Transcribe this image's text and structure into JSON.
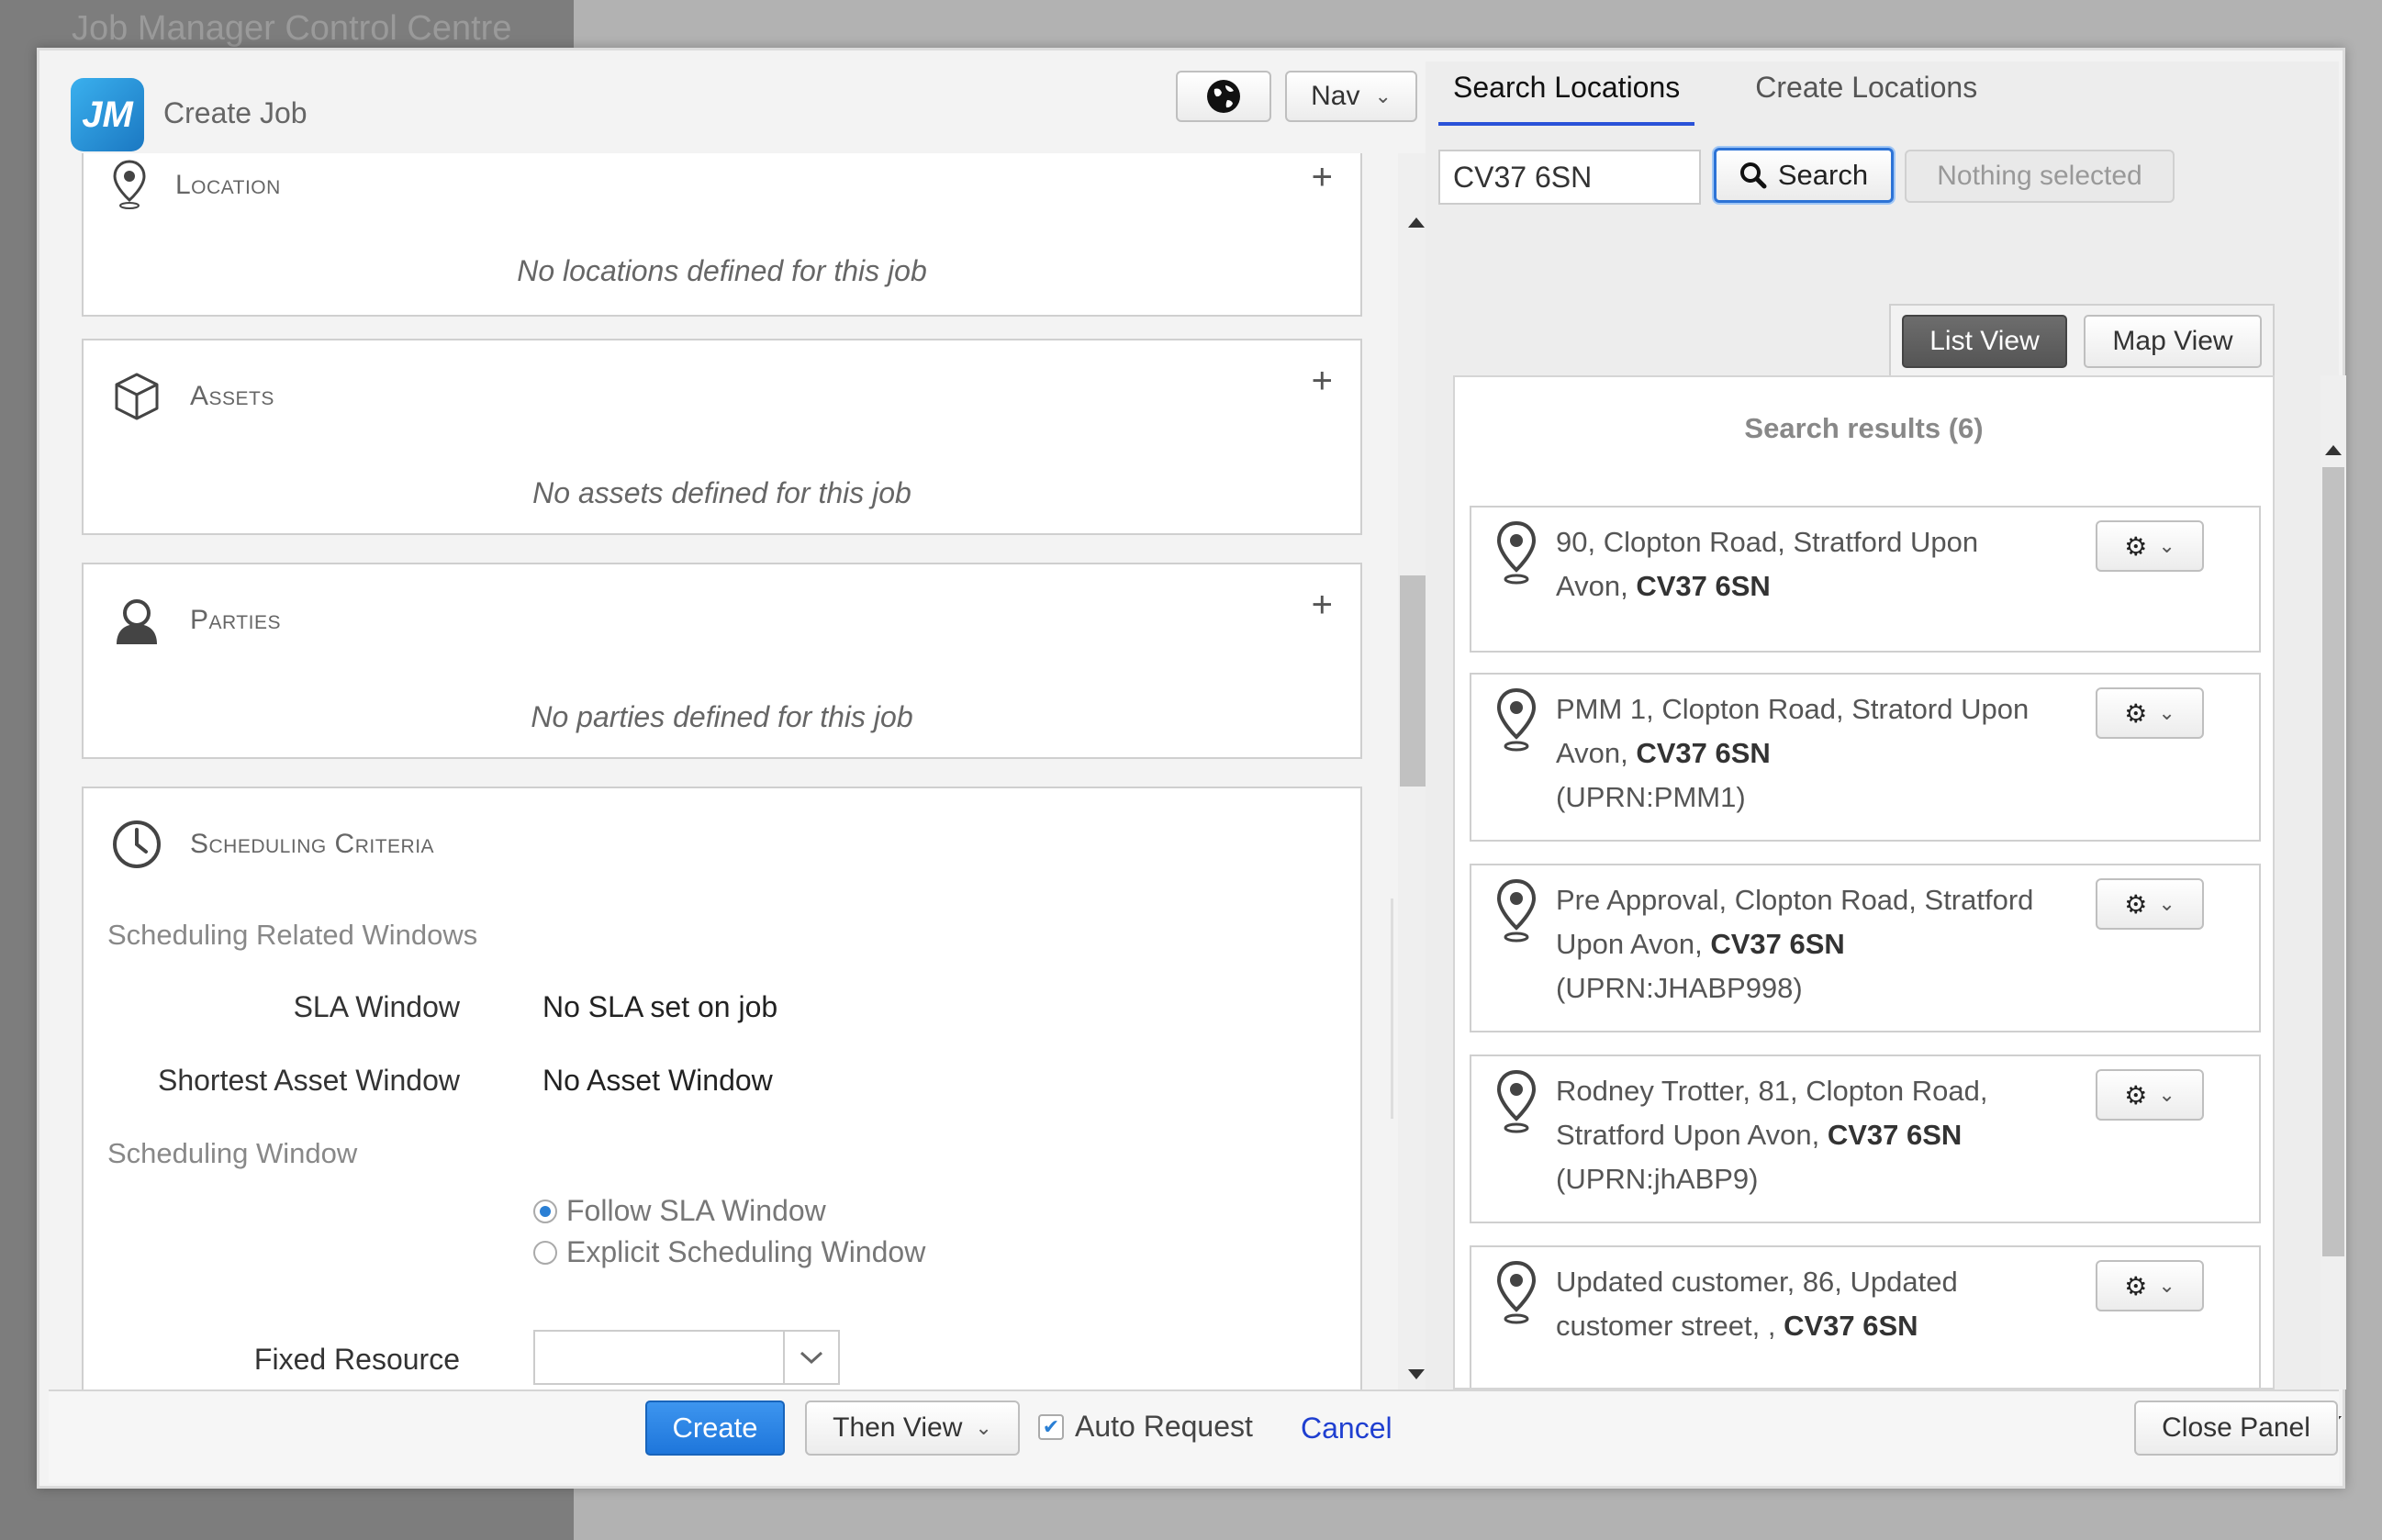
{
  "background_title": "Job Manager Control Centre",
  "header": {
    "logo_text": "JM",
    "title": "Create Job",
    "nav_label": "Nav"
  },
  "sections": {
    "location": {
      "title": "Location",
      "empty": "No locations defined for this job"
    },
    "assets": {
      "title": "Assets",
      "empty": "No assets defined for this job"
    },
    "parties": {
      "title": "Parties",
      "empty": "No parties defined for this job"
    },
    "scheduling": {
      "title": "Scheduling Criteria",
      "related_windows_label": "Scheduling Related Windows",
      "sla_window_label": "SLA Window",
      "sla_window_value": "No SLA set on job",
      "shortest_asset_label": "Shortest Asset Window",
      "shortest_asset_value": "No Asset Window",
      "scheduling_window_label": "Scheduling Window",
      "option_follow_sla": "Follow SLA Window",
      "option_explicit": "Explicit Scheduling Window",
      "selected_option": "Follow SLA Window",
      "fixed_resource_label": "Fixed Resource",
      "fixed_resource_value": ""
    }
  },
  "footer": {
    "create_label": "Create",
    "then_view_label": "Then View",
    "auto_request_label": "Auto Request",
    "auto_request_checked": true,
    "cancel_label": "Cancel",
    "close_panel_label": "Close Panel"
  },
  "right_panel": {
    "tabs": [
      "Search Locations",
      "Create Locations"
    ],
    "active_tab": "Search Locations",
    "search_value": "CV37 6SN",
    "search_button_label": "Search",
    "selection_label": "Nothing selected",
    "list_view_label": "List View",
    "map_view_label": "Map View",
    "active_view": "List View",
    "results_title": "Search results (6)",
    "results": [
      {
        "text": "90, Clopton Road, Stratford Upon Avon, ",
        "postcode": "CV37 6SN",
        "uprn": ""
      },
      {
        "text": "PMM 1, Clopton Road, Stratord Upon Avon, ",
        "postcode": "CV37 6SN",
        "uprn": "(UPRN:PMM1)"
      },
      {
        "text": "Pre Approval, Clopton Road, Stratford Upon Avon, ",
        "postcode": "CV37 6SN",
        "uprn": "(UPRN:JHABP998)"
      },
      {
        "text": "Rodney Trotter, 81, Clopton Road, Stratford Upon Avon, ",
        "postcode": "CV37 6SN",
        "uprn": "(UPRN:jhABP9)"
      },
      {
        "text": "Updated customer, 86, Updated customer street, , ",
        "postcode": "CV37 6SN",
        "uprn": ""
      }
    ]
  },
  "colors": {
    "accent": "#1e76db",
    "tab_underline": "#2a52d8",
    "link": "#1f3fd0",
    "list_view_active": "#5f5f5f"
  },
  "icons": {
    "globe": "globe-icon",
    "location": "location-pin-icon",
    "assets": "cube-icon",
    "parties": "person-icon",
    "scheduling": "clock-icon",
    "search": "search-icon",
    "gear": "gear-icon"
  }
}
